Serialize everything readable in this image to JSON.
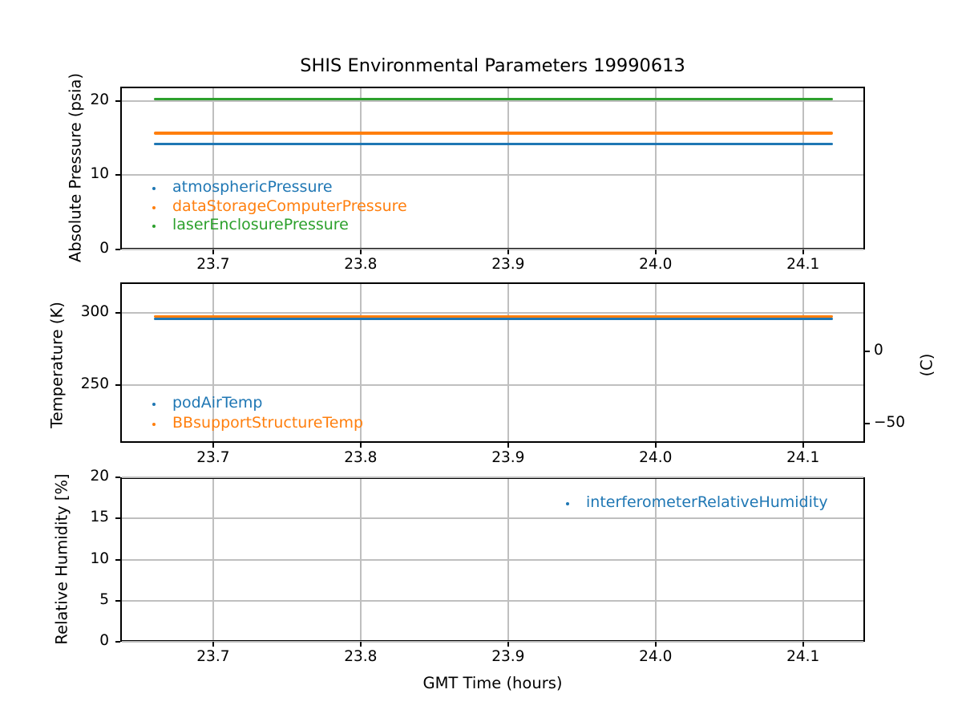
{
  "figure": {
    "title": "SHIS Environmental Parameters 19990613",
    "background": "#ffffff",
    "grid_color": "#bfbfbf",
    "spine_color": "#000000"
  },
  "chart_data": [
    {
      "type": "line",
      "panel": "absolute-pressure",
      "title": "SHIS Environmental Parameters 19990613",
      "ylabel": "Absolute Pressure (psia)",
      "xlabel": "",
      "xlim": [
        23.637,
        24.142
      ],
      "ylim": [
        0,
        22
      ],
      "grid": true,
      "legend_loc": "lower left",
      "xticks": [
        {
          "value": 23.7,
          "label": "23.7"
        },
        {
          "value": 23.8,
          "label": "23.8"
        },
        {
          "value": 23.9,
          "label": "23.9"
        },
        {
          "value": 24.0,
          "label": "24.0"
        },
        {
          "value": 24.1,
          "label": "24.1"
        }
      ],
      "yticks": [
        {
          "value": 0,
          "label": "0"
        },
        {
          "value": 10,
          "label": "10"
        },
        {
          "value": 20,
          "label": "20"
        }
      ],
      "series": [
        {
          "name": "atmosphericPressure",
          "color": "#1f77b4",
          "shape": "constant",
          "value": 14.2,
          "x_start": 23.66,
          "x_end": 24.12,
          "visible": true
        },
        {
          "name": "dataStorageComputerPressure",
          "color": "#ff7f0e",
          "shape": "constant",
          "value": 15.65,
          "x_start": 23.66,
          "x_end": 24.12,
          "visible": true
        },
        {
          "name": "laserEnclosurePressure",
          "color": "#2ca02c",
          "shape": "constant",
          "value": 20.3,
          "x_start": 23.66,
          "x_end": 24.12,
          "visible": true
        }
      ]
    },
    {
      "type": "line",
      "panel": "temperature",
      "ylabel": "Temperature (K)",
      "ylabel_right": "(C)",
      "xlabel": "",
      "xlim": [
        23.637,
        24.142
      ],
      "ylim": [
        210,
        321.3
      ],
      "grid": true,
      "legend_loc": "lower left",
      "xticks": [
        {
          "value": 23.7,
          "label": "23.7"
        },
        {
          "value": 23.8,
          "label": "23.8"
        },
        {
          "value": 23.9,
          "label": "23.9"
        },
        {
          "value": 24.0,
          "label": "24.0"
        },
        {
          "value": 24.1,
          "label": "24.1"
        }
      ],
      "yticks": [
        {
          "value": 250,
          "label": "250"
        },
        {
          "value": 300,
          "label": "300"
        }
      ],
      "yticks_right": [
        {
          "value": 273.15,
          "label": "0"
        },
        {
          "value": 223.15,
          "label": "−50"
        }
      ],
      "series": [
        {
          "name": "podAirTemp",
          "color": "#1f77b4",
          "shape": "constant",
          "value": 295.7,
          "x_start": 23.66,
          "x_end": 24.12,
          "visible": true
        },
        {
          "name": "BBsupportStructureTemp",
          "color": "#ff7f0e",
          "shape": "constant",
          "value": 297.6,
          "x_start": 23.66,
          "x_end": 24.12,
          "visible": true
        }
      ]
    },
    {
      "type": "line",
      "panel": "relative-humidity",
      "ylabel": "Relative Humidity [%]",
      "xlabel": "GMT Time (hours)",
      "xlim": [
        23.637,
        24.142
      ],
      "ylim": [
        0,
        20
      ],
      "grid": true,
      "legend_loc": "upper right",
      "xticks": [
        {
          "value": 23.7,
          "label": "23.7"
        },
        {
          "value": 23.8,
          "label": "23.8"
        },
        {
          "value": 23.9,
          "label": "23.9"
        },
        {
          "value": 24.0,
          "label": "24.0"
        },
        {
          "value": 24.1,
          "label": "24.1"
        }
      ],
      "yticks": [
        {
          "value": 0,
          "label": "0"
        },
        {
          "value": 5,
          "label": "5"
        },
        {
          "value": 10,
          "label": "10"
        },
        {
          "value": 15,
          "label": "15"
        },
        {
          "value": 20,
          "label": "20"
        }
      ],
      "series": [
        {
          "name": "interferometerRelativeHumidity",
          "color": "#1f77b4",
          "shape": "constant",
          "value": null,
          "x_start": 23.66,
          "x_end": 24.12,
          "visible": false
        }
      ]
    }
  ]
}
